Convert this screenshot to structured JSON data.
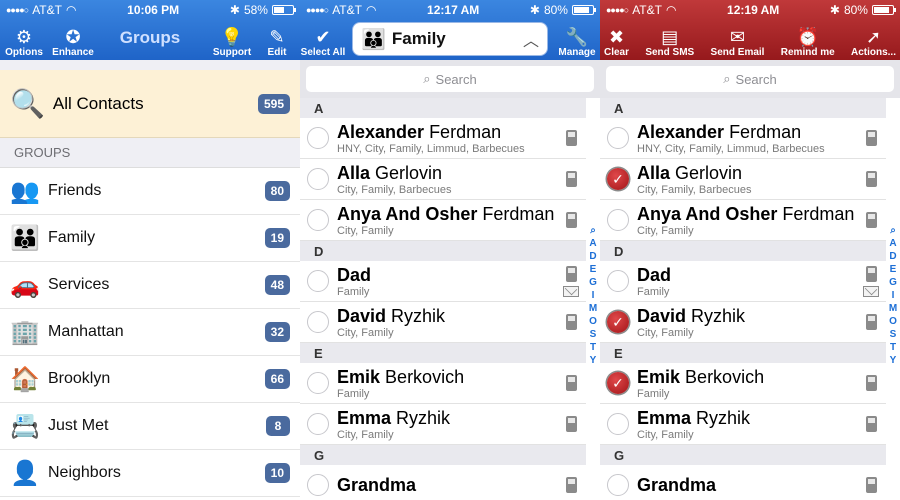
{
  "status": [
    {
      "carrier": "AT&T",
      "time": "10:06 PM",
      "battery": "58%",
      "level": 0.58
    },
    {
      "carrier": "AT&T",
      "time": "12:17 AM",
      "battery": "80%",
      "level": 0.8
    },
    {
      "carrier": "AT&T",
      "time": "12:19 AM",
      "battery": "80%",
      "level": 0.8
    }
  ],
  "groups_screen": {
    "title": "Groups",
    "toolbar": {
      "options": "Options",
      "enhance": "Enhance",
      "support": "Support",
      "edit": "Edit"
    },
    "all_contacts": {
      "label": "All Contacts",
      "count": "595"
    },
    "section_label": "GROUPS",
    "groups": [
      {
        "label": "Friends",
        "count": "80",
        "icon": "people-icon"
      },
      {
        "label": "Family",
        "count": "19",
        "icon": "family-icon"
      },
      {
        "label": "Services",
        "count": "48",
        "icon": "car-icon"
      },
      {
        "label": "Manhattan",
        "count": "32",
        "icon": "building-icon"
      },
      {
        "label": "Brooklyn",
        "count": "66",
        "icon": "house-icon"
      },
      {
        "label": "Just Met",
        "count": "8",
        "icon": "card-icon"
      },
      {
        "label": "Neighbors",
        "count": "10",
        "icon": "person-icon"
      }
    ]
  },
  "family_screen": {
    "toolbar": {
      "select_all": "Select All",
      "manage": "Manage"
    },
    "group_title": "Family"
  },
  "action_screen": {
    "toolbar": {
      "clear": "Clear",
      "send_sms": "Send SMS",
      "send_email": "Send Email",
      "remind_me": "Remind me",
      "actions": "Actions..."
    }
  },
  "search_placeholder": "Search",
  "index_letters": [
    "A",
    "D",
    "E",
    "G",
    "I",
    "M",
    "O",
    "S",
    "T",
    "Y"
  ],
  "sections": [
    {
      "letter": "A",
      "contacts": [
        {
          "first": "Alexander",
          "last": "Ferdman",
          "groups": "HNY, City, Family, Limmud, Barbecues"
        },
        {
          "first": "Alla",
          "last": "Gerlovin",
          "groups": "City, Family, Barbecues"
        },
        {
          "first": "Anya And Osher",
          "last": "Ferdman",
          "groups": "City, Family"
        }
      ]
    },
    {
      "letter": "D",
      "contacts": [
        {
          "first": "Dad",
          "last": "",
          "groups": "Family"
        },
        {
          "first": "David",
          "last": "Ryzhik",
          "groups": "City, Family"
        }
      ]
    },
    {
      "letter": "E",
      "contacts": [
        {
          "first": "Emik",
          "last": "Berkovich",
          "groups": "Family"
        },
        {
          "first": "Emma",
          "last": "Ryzhik",
          "groups": "City, Family"
        }
      ]
    },
    {
      "letter": "G",
      "contacts": [
        {
          "first": "Grandma",
          "last": "",
          "groups": ""
        }
      ]
    }
  ],
  "selected_in_action_screen": [
    "Alla Gerlovin",
    "David Ryzhik",
    "Emik Berkovich"
  ]
}
